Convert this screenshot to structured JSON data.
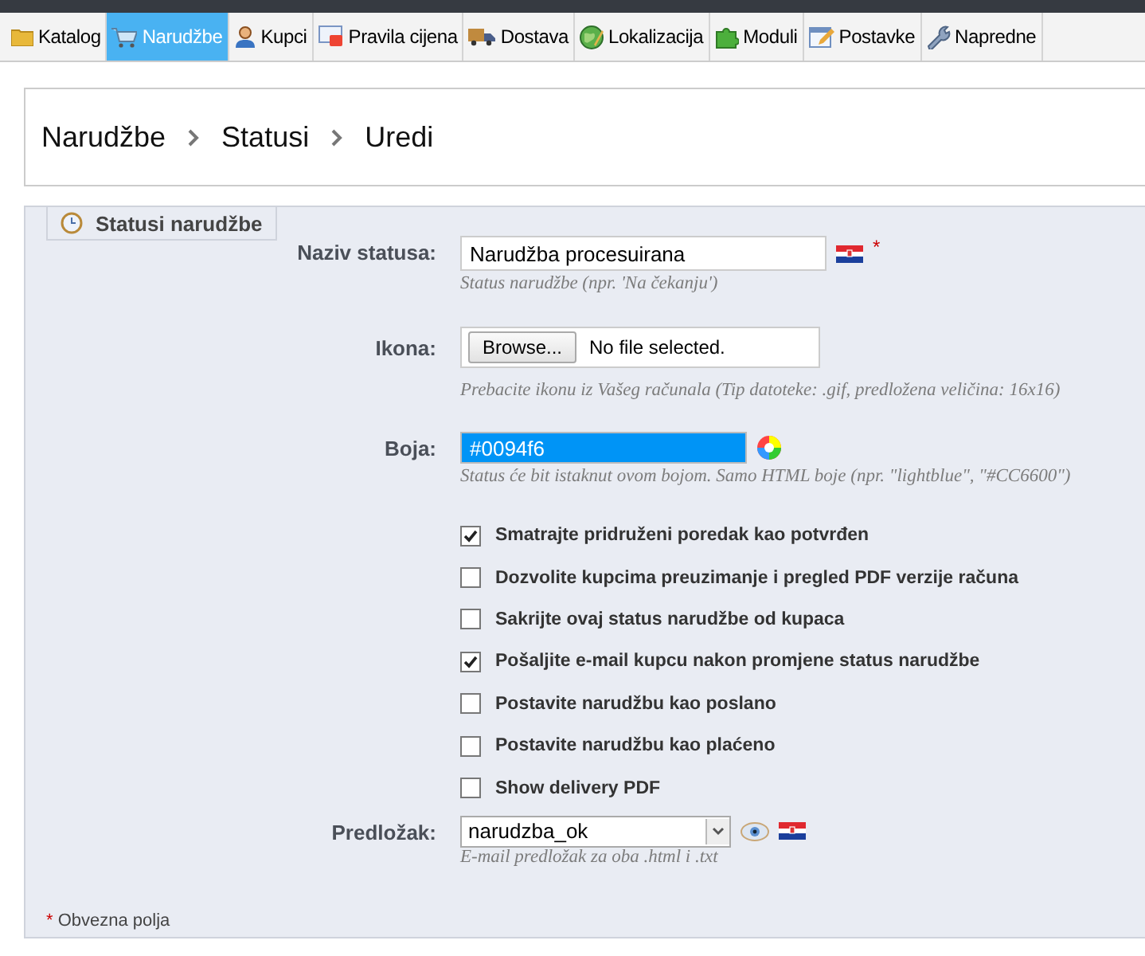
{
  "menu": [
    {
      "label": "Katalog",
      "selected": false
    },
    {
      "label": "Narudžbe",
      "selected": true
    },
    {
      "label": "Kupci",
      "selected": false
    },
    {
      "label": "Pravila cijena",
      "selected": false
    },
    {
      "label": "Dostava",
      "selected": false
    },
    {
      "label": "Lokalizacija",
      "selected": false
    },
    {
      "label": "Moduli",
      "selected": false
    },
    {
      "label": "Postavke",
      "selected": false
    },
    {
      "label": "Napredne",
      "selected": false
    }
  ],
  "breadcrumb": [
    "Narudžbe",
    "Statusi",
    "Uredi"
  ],
  "legend": "Statusi narudžbe",
  "fields": [
    {
      "kind": "text",
      "label": "Naziv statusa:",
      "value": "Narudžba procesuirana",
      "required": "*",
      "hint": "Status narudžbe (npr. 'Na čekanju')"
    },
    {
      "kind": "file",
      "label": "Ikona:",
      "button": "Browse...",
      "value": "No file selected.",
      "hint": "Prebacite ikonu iz Vašeg računala (Tip datoteke: .gif, predložena veličina: 16x16)"
    },
    {
      "kind": "color",
      "label": "Boja:",
      "value": "#0094f6",
      "color": "#0094f6",
      "hint": "Status će bit istaknut ovom bojom. Samo HTML boje (npr. \"lightblue\", \"#CC6600\")"
    }
  ],
  "checkboxes": [
    {
      "label": "Smatrajte pridruženi poredak kao potvrđen",
      "checked": true
    },
    {
      "label": "Dozvolite kupcima preuzimanje i pregled PDF verzije računa",
      "checked": false
    },
    {
      "label": "Sakrijte ovaj status narudžbe od kupaca",
      "checked": false
    },
    {
      "label": "Pošaljite e-mail kupcu nakon promjene status narudžbe",
      "checked": true
    },
    {
      "label": "Postavite narudžbu kao poslano",
      "checked": false
    },
    {
      "label": "Postavite narudžbu kao plaćeno",
      "checked": false
    },
    {
      "label": "Show delivery PDF",
      "checked": false
    }
  ],
  "template": {
    "label": "Predložak:",
    "value": "narudzba_ok",
    "hint": "E-mail predložak za oba .html i .txt"
  },
  "footnote": {
    "mark": "*",
    "text": "Obvezna polja"
  }
}
